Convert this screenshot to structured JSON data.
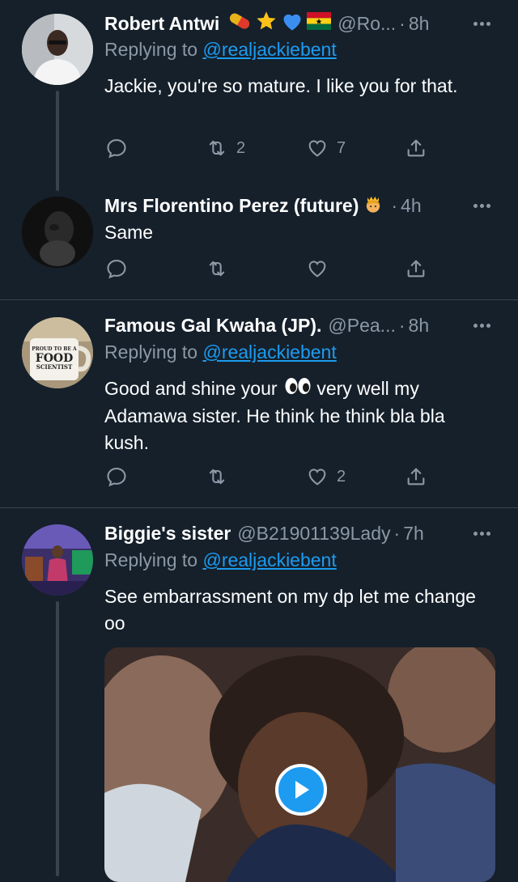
{
  "colors": {
    "background": "#15202b",
    "text_primary": "#ffffff",
    "text_secondary": "#8b98a5",
    "link": "#1d9bf0",
    "divider": "#38444d"
  },
  "tweets": [
    {
      "name": "Robert Antwi",
      "name_emojis": [
        "pill-emoji",
        "star-emoji",
        "blue-heart-emoji",
        "ghana-flag-emoji"
      ],
      "handle": "@Ro...",
      "sep": "·",
      "time": "8h",
      "replying_prefix": "Replying to ",
      "replying_to": "@realjackiebent",
      "text": "Jackie, you're so mature. I like you for that.",
      "retweets": "2",
      "likes": "7"
    },
    {
      "name": "Mrs Florentino Perez (future)",
      "name_emojis": [
        "princess-emoji"
      ],
      "sep": "·",
      "time": "4h",
      "text": "Same",
      "retweets": "",
      "likes": ""
    },
    {
      "name": "Famous Gal Kwaha (JP).",
      "handle": "@Pea...",
      "sep": "·",
      "time": "8h",
      "replying_prefix": "Replying to ",
      "replying_to": "@realjackiebent",
      "text_before_emoji": "Good and shine your",
      "text_emoji": "eyes-emoji",
      "text_after_emoji": " very well my Adamawa sister. He think he think bla bla kush.",
      "retweets": "",
      "likes": "2",
      "avatar_mug_text": [
        "PROUD TO BE A",
        "FOOD",
        "SCIENTIST"
      ]
    },
    {
      "name": "Biggie's sister",
      "handle": "@B21901139Lady",
      "sep": "·",
      "time": "7h",
      "replying_prefix": "Replying to ",
      "replying_to": "@realjackiebent",
      "text": "See embarrassment on my dp let me change oo",
      "media": "video-thumbnail"
    }
  ],
  "icons": {
    "reply": "reply-icon",
    "retweet": "retweet-icon",
    "like": "heart-icon",
    "share": "share-icon",
    "more": "more-icon",
    "play": "play-icon"
  }
}
